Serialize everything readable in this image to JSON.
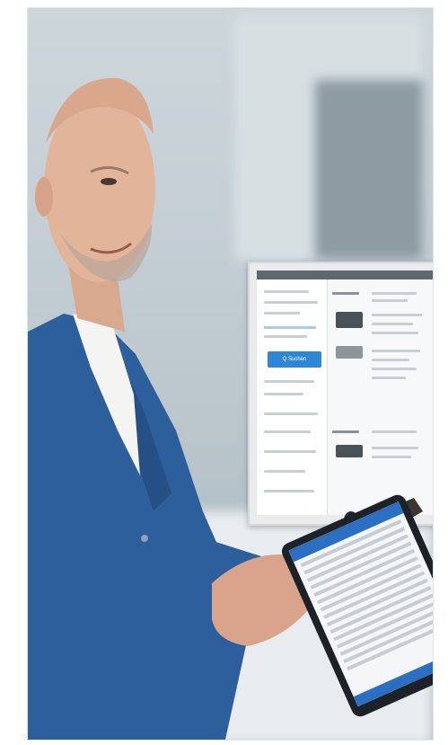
{
  "monitor": {
    "search_button_label": "Q Suchen"
  },
  "colors": {
    "accent": "#2f86d6",
    "jacket": "#2e5f9d",
    "background": "#c1ccd2"
  }
}
